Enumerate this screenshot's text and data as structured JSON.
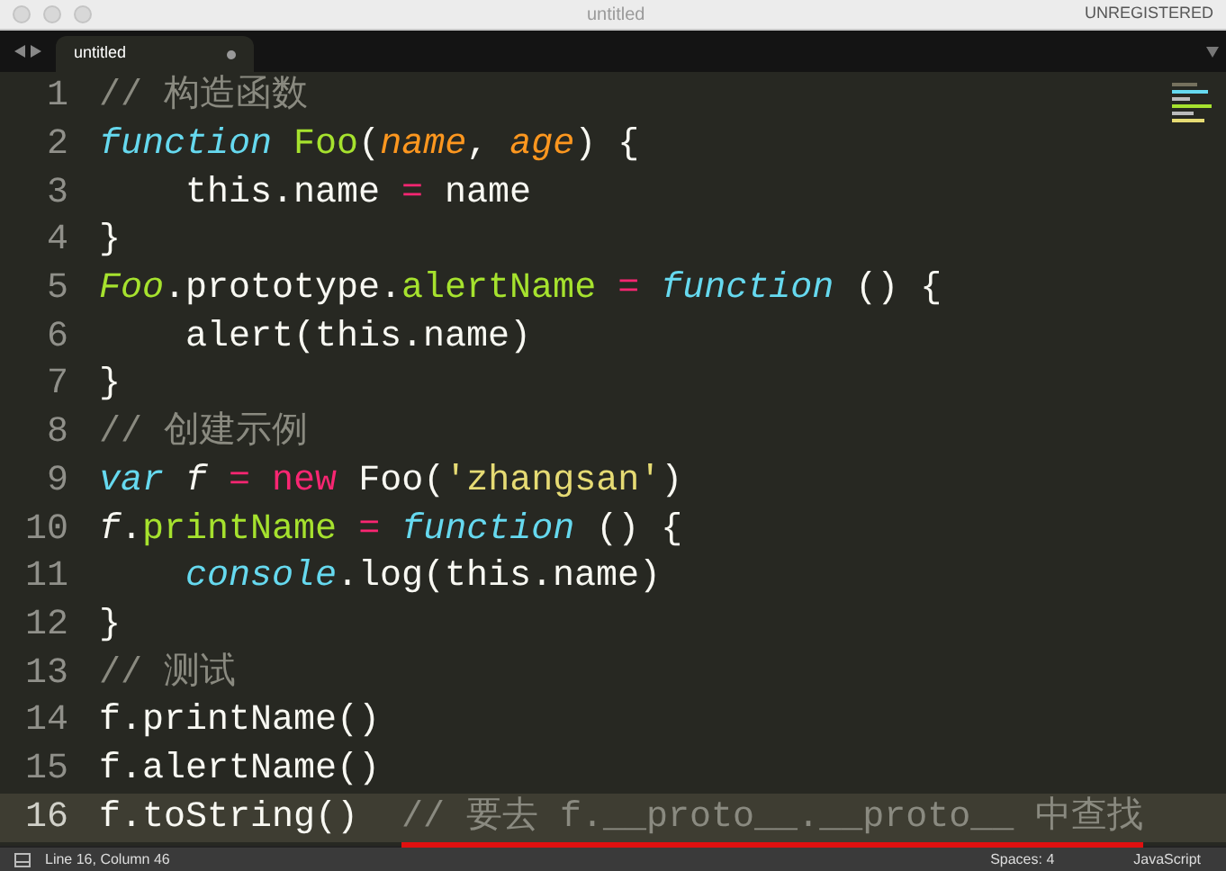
{
  "window": {
    "title": "untitled",
    "license": "UNREGISTERED"
  },
  "tabs": [
    {
      "label": "untitled",
      "selected": true,
      "modified": true
    }
  ],
  "editor": {
    "lines": [
      {
        "number": "1",
        "current": false,
        "tokens": [
          {
            "kind": "comment",
            "text": "// 构造函数"
          }
        ]
      },
      {
        "number": "2",
        "current": false,
        "tokens": [
          {
            "kind": "keyword",
            "text": "function "
          },
          {
            "kind": "function",
            "text": "Foo"
          },
          {
            "kind": "plain",
            "text": "("
          },
          {
            "kind": "param",
            "text": "name"
          },
          {
            "kind": "plain",
            "text": ", "
          },
          {
            "kind": "param",
            "text": "age"
          },
          {
            "kind": "plain",
            "text": ") {"
          }
        ]
      },
      {
        "number": "3",
        "current": false,
        "tokens": [
          {
            "kind": "plain",
            "text": "    this.name "
          },
          {
            "kind": "operator",
            "text": "= "
          },
          {
            "kind": "plain",
            "text": "name"
          }
        ]
      },
      {
        "number": "4",
        "current": false,
        "tokens": [
          {
            "kind": "plain",
            "text": "}"
          }
        ]
      },
      {
        "number": "5",
        "current": false,
        "tokens": [
          {
            "kind": "type",
            "text": "Foo"
          },
          {
            "kind": "plain",
            "text": ".prototype."
          },
          {
            "kind": "function",
            "text": "alertName "
          },
          {
            "kind": "operator",
            "text": "= "
          },
          {
            "kind": "keyword",
            "text": "function"
          },
          {
            "kind": "plain",
            "text": " () {"
          }
        ]
      },
      {
        "number": "6",
        "current": false,
        "tokens": [
          {
            "kind": "plain",
            "text": "    alert(this.name)"
          }
        ]
      },
      {
        "number": "7",
        "current": false,
        "tokens": [
          {
            "kind": "plain",
            "text": "}"
          }
        ]
      },
      {
        "number": "8",
        "current": false,
        "tokens": [
          {
            "kind": "comment",
            "text": "// 创建示例"
          }
        ]
      },
      {
        "number": "9",
        "current": false,
        "tokens": [
          {
            "kind": "keyword",
            "text": "var "
          },
          {
            "kind": "variable",
            "text": "f "
          },
          {
            "kind": "operator",
            "text": "= "
          },
          {
            "kind": "operator",
            "text": "new "
          },
          {
            "kind": "plain",
            "text": "Foo("
          },
          {
            "kind": "string",
            "text": "'zhangsan'"
          },
          {
            "kind": "plain",
            "text": ")"
          }
        ]
      },
      {
        "number": "10",
        "current": false,
        "tokens": [
          {
            "kind": "variable",
            "text": "f"
          },
          {
            "kind": "plain",
            "text": "."
          },
          {
            "kind": "function",
            "text": "printName "
          },
          {
            "kind": "operator",
            "text": "= "
          },
          {
            "kind": "keyword",
            "text": "function"
          },
          {
            "kind": "plain",
            "text": " () {"
          }
        ]
      },
      {
        "number": "11",
        "current": false,
        "tokens": [
          {
            "kind": "keyword",
            "text": "    console"
          },
          {
            "kind": "plain",
            "text": ".log(this.name)"
          }
        ]
      },
      {
        "number": "12",
        "current": false,
        "tokens": [
          {
            "kind": "plain",
            "text": "}"
          }
        ]
      },
      {
        "number": "13",
        "current": false,
        "tokens": [
          {
            "kind": "comment",
            "text": "// 测试"
          }
        ]
      },
      {
        "number": "14",
        "current": false,
        "tokens": [
          {
            "kind": "plain",
            "text": "f.printName()"
          }
        ]
      },
      {
        "number": "15",
        "current": false,
        "tokens": [
          {
            "kind": "plain",
            "text": "f.alertName()"
          }
        ]
      },
      {
        "number": "16",
        "current": true,
        "tokens": [
          {
            "kind": "plain",
            "text": "f.toString()  "
          },
          {
            "kind": "comment",
            "text": "// 要去 f.__proto__.__proto__ 中查找",
            "underlined": true
          }
        ]
      }
    ]
  },
  "status_bar": {
    "position": "Line 16, Column 46",
    "indentation": "Spaces: 4",
    "syntax": "JavaScript"
  }
}
